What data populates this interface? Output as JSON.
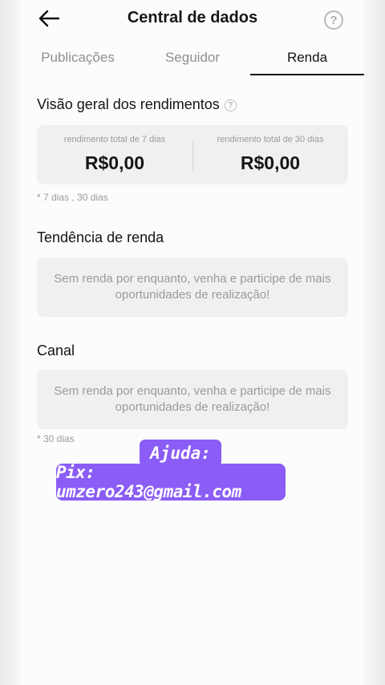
{
  "header": {
    "title": "Central de dados",
    "back_icon": "arrow-left-icon",
    "help_glyph": "?"
  },
  "tabs": [
    {
      "label": "Publicações",
      "active": false
    },
    {
      "label": "Seguidor",
      "active": false
    },
    {
      "label": "Renda",
      "active": true
    }
  ],
  "overview": {
    "title": "Visão geral dos rendimentos",
    "info_glyph": "?",
    "items": [
      {
        "label": "rendimento total de 7 dias",
        "value": "R$0,00"
      },
      {
        "label": "rendimento total de 30 dias",
        "value": "R$0,00"
      }
    ],
    "note": "* 7 dias , 30 dias"
  },
  "trend": {
    "title": "Tendência de renda",
    "empty_text": "Sem renda por enquanto, venha e participe de mais oportunidades de realização!"
  },
  "channel": {
    "title": "Canal",
    "empty_text": "Sem renda por enquanto, venha e participe de mais oportunidades de realização!",
    "note": "* 30 dias"
  },
  "overlay": {
    "line1": "Ajuda:",
    "line2": "Pix: umzero243@gmail.com",
    "bg_color": "#8b5cf6"
  }
}
